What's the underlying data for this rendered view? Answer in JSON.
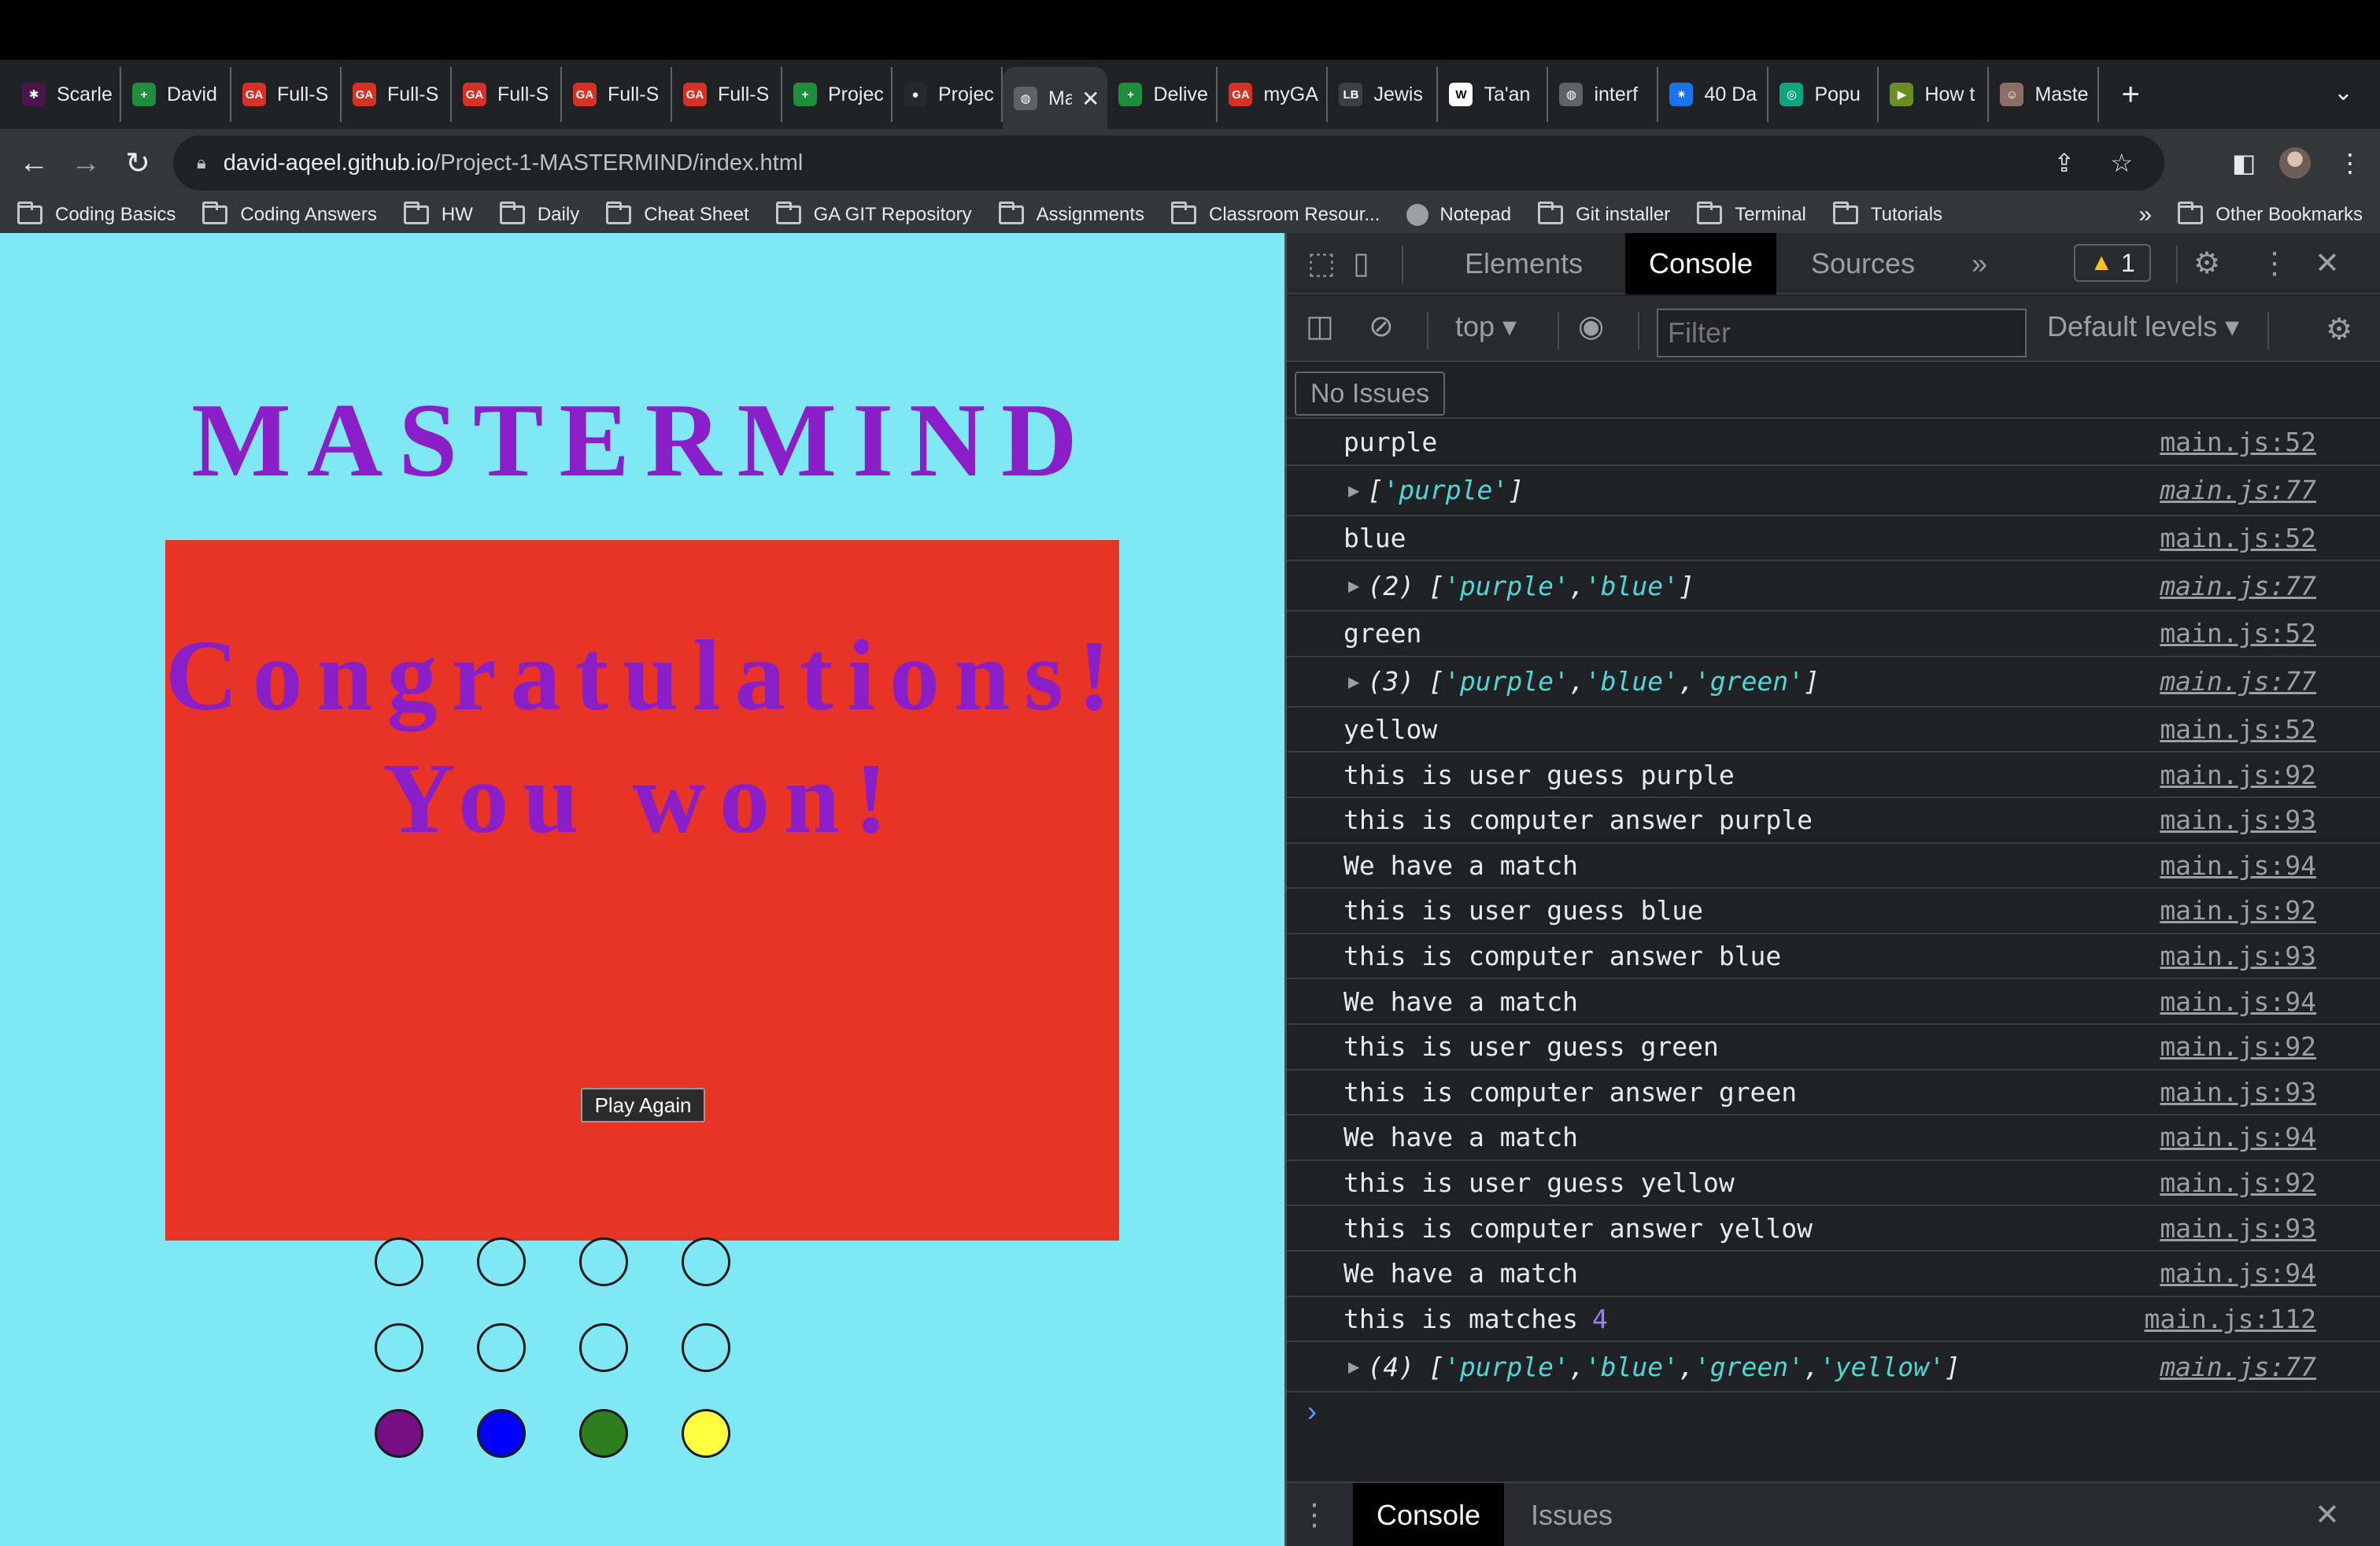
{
  "browser": {
    "tabs": [
      {
        "title": "Scarle",
        "icon": "slack-icon",
        "color": "#4a154b"
      },
      {
        "title": "David",
        "icon": "sheets-icon",
        "color": "#1e8e3e"
      },
      {
        "title": "Full-S",
        "icon": "ga-icon",
        "color": "#d93025"
      },
      {
        "title": "Full-S",
        "icon": "ga-icon",
        "color": "#d93025"
      },
      {
        "title": "Full-S",
        "icon": "ga-icon",
        "color": "#d93025"
      },
      {
        "title": "Full-S",
        "icon": "ga-icon",
        "color": "#d93025"
      },
      {
        "title": "Full-S",
        "icon": "ga-icon",
        "color": "#d93025"
      },
      {
        "title": "Projec",
        "icon": "sheets-icon",
        "color": "#1e8e3e"
      },
      {
        "title": "Projec",
        "icon": "github-icon",
        "color": "#24292e"
      },
      {
        "title": "Ma",
        "icon": "globe-icon",
        "color": "#5f6368",
        "active": true
      },
      {
        "title": "Delive",
        "icon": "sheets-icon",
        "color": "#1e8e3e"
      },
      {
        "title": "myGA",
        "icon": "ga-icon",
        "color": "#d93025"
      },
      {
        "title": "Jewis",
        "icon": "lb-icon",
        "color": "#3c4043"
      },
      {
        "title": "Ta'an",
        "icon": "wikipedia-icon",
        "color": "#ffffff"
      },
      {
        "title": "interf",
        "icon": "globe-icon",
        "color": "#5f6368"
      },
      {
        "title": "40 Da",
        "icon": "gear-icon",
        "color": "#1a73e8"
      },
      {
        "title": "Popu",
        "icon": "openai-icon",
        "color": "#10a37f"
      },
      {
        "title": "How t",
        "icon": "video-icon",
        "color": "#6b8e23"
      },
      {
        "title": "Maste",
        "icon": "profile-icon",
        "color": "#8d6e63"
      }
    ],
    "url_host": "david-aqeel.github.io",
    "url_path": "/Project-1-MASTERMIND/index.html",
    "bookmarks": [
      "Coding Basics",
      "Coding Answers",
      "HW",
      "Daily",
      "Cheat Sheet",
      "GA GIT Repository",
      "Assignments",
      "Classroom Resour...",
      "Notepad",
      "Git installer",
      "Terminal",
      "Tutorials"
    ],
    "bookmarks_more": "»",
    "other_bookmarks": "Other Bookmarks"
  },
  "game": {
    "title": "MASTERMIND",
    "win_line1": "Congratulations!",
    "win_line2": "You won!",
    "play_again_label": "Play Again",
    "peg_rows": [
      [
        "#80e8f4",
        "#80e8f4",
        "#80e8f4",
        "#80e8f4"
      ],
      [
        "#80e8f4",
        "#80e8f4",
        "#80e8f4",
        "#80e8f4"
      ],
      [
        "#760e84",
        "#0000ff",
        "#2e7d1e",
        "#ffff40"
      ]
    ],
    "colors": {
      "background": "#80e8f4",
      "title": "#8a1ec8",
      "panel": "#e83426"
    }
  },
  "devtools": {
    "tabs": {
      "elements": "Elements",
      "console": "Console",
      "sources": "Sources",
      "more": "»"
    },
    "warnings_count": "1",
    "context": "top",
    "filter_placeholder": "Filter",
    "levels": "Default levels",
    "no_issues": "No Issues",
    "logs": [
      {
        "type": "text",
        "text": "purple",
        "src": "main.js:52"
      },
      {
        "type": "array",
        "count": "",
        "items": [
          "purple"
        ],
        "src": "main.js:77"
      },
      {
        "type": "text",
        "text": "blue",
        "src": "main.js:52"
      },
      {
        "type": "array",
        "count": "(2)",
        "items": [
          "purple",
          "blue"
        ],
        "src": "main.js:77"
      },
      {
        "type": "text",
        "text": "green",
        "src": "main.js:52"
      },
      {
        "type": "array",
        "count": "(3)",
        "items": [
          "purple",
          "blue",
          "green"
        ],
        "src": "main.js:77"
      },
      {
        "type": "text",
        "text": "yellow",
        "src": "main.js:52"
      },
      {
        "type": "text",
        "text": "this is user guess purple",
        "src": "main.js:92"
      },
      {
        "type": "text",
        "text": "this is computer answer purple",
        "src": "main.js:93"
      },
      {
        "type": "text",
        "text": "We have a match",
        "src": "main.js:94"
      },
      {
        "type": "text",
        "text": "this is user guess blue",
        "src": "main.js:92"
      },
      {
        "type": "text",
        "text": "this is computer answer blue",
        "src": "main.js:93"
      },
      {
        "type": "text",
        "text": "We have a match",
        "src": "main.js:94"
      },
      {
        "type": "text",
        "text": "this is user guess green",
        "src": "main.js:92"
      },
      {
        "type": "text",
        "text": "this is computer answer green",
        "src": "main.js:93"
      },
      {
        "type": "text",
        "text": "We have a match",
        "src": "main.js:94"
      },
      {
        "type": "text",
        "text": "this is user guess yellow",
        "src": "main.js:92"
      },
      {
        "type": "text",
        "text": "this is computer answer yellow",
        "src": "main.js:93"
      },
      {
        "type": "text",
        "text": "We have a match",
        "src": "main.js:94"
      },
      {
        "type": "text",
        "text": "this is matches",
        "number": "4",
        "src": "main.js:112"
      },
      {
        "type": "array",
        "count": "(4)",
        "items": [
          "purple",
          "blue",
          "green",
          "yellow"
        ],
        "src": "main.js:77"
      }
    ],
    "prompt": "›",
    "drawer": {
      "console": "Console",
      "issues": "Issues"
    }
  }
}
